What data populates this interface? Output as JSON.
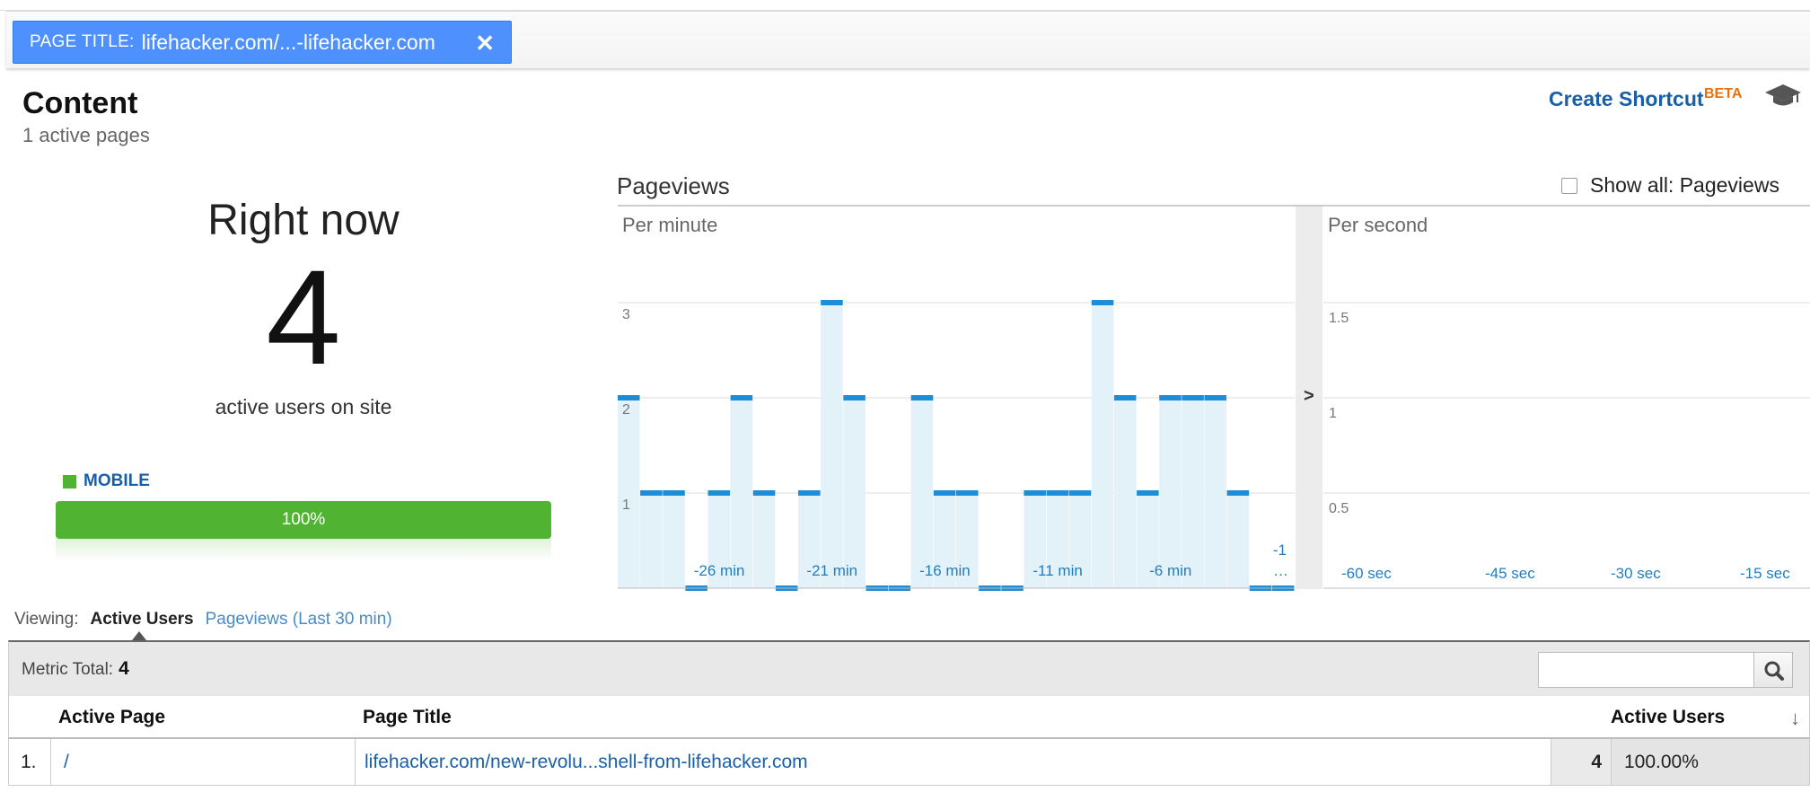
{
  "filter": {
    "label": "PAGE TITLE:",
    "value": "lifehacker.com/...-lifehacker.com",
    "close_glyph": "✕"
  },
  "header": {
    "title": "Content",
    "subtitle": "1 active pages",
    "shortcut_label": "Create Shortcut",
    "beta_label": "BETA"
  },
  "overview": {
    "right_now_label": "Right now",
    "active_users": "4",
    "active_users_label": "active users on site",
    "device": {
      "name": "MOBILE",
      "percent_label": "100%",
      "share": 1.0,
      "color": "#50b432"
    }
  },
  "pageviews": {
    "title": "Pageviews",
    "show_all_label": "Show all: Pageviews",
    "per_minute_label": "Per minute",
    "per_second_label": "Per second"
  },
  "chart_data": [
    {
      "type": "bar",
      "title": "Per minute",
      "x": [
        -30,
        -29,
        -28,
        -27,
        -26,
        -25,
        -24,
        -23,
        -22,
        -21,
        -20,
        -19,
        -18,
        -17,
        -16,
        -15,
        -14,
        -13,
        -12,
        -11,
        -10,
        -9,
        -8,
        -7,
        -6,
        -5,
        -4,
        -3,
        -2,
        -1
      ],
      "values": [
        2,
        1,
        1,
        0,
        1,
        2,
        1,
        0,
        1,
        3,
        2,
        0,
        0,
        2,
        1,
        1,
        0,
        0,
        1,
        1,
        1,
        3,
        2,
        1,
        2,
        2,
        2,
        1,
        0,
        0
      ],
      "x_tick_labels": [
        "-26 min",
        "-21 min",
        "-16 min",
        "-11 min",
        "-6 min"
      ],
      "x_last_label": [
        "-1",
        "…"
      ],
      "y_tick_labels": [
        "1",
        "2",
        "3"
      ],
      "ylim": [
        0,
        4
      ],
      "bar_color": "#1f8dd6",
      "fill_color": "#e3f1f9"
    },
    {
      "type": "bar",
      "title": "Per second",
      "x_tick_labels": [
        "-60 sec",
        "-45 sec",
        "-30 sec",
        "-15 sec"
      ],
      "y_tick_labels": [
        "0.5",
        "1",
        "1.5"
      ],
      "ylim": [
        0,
        2
      ],
      "values": []
    }
  ],
  "viewing": {
    "label": "Viewing:",
    "active_tab": "Active Users",
    "other_tab": "Pageviews (Last 30 min)"
  },
  "table": {
    "metric_total_label": "Metric Total:",
    "metric_total_value": "4",
    "columns": [
      "Active Page",
      "Page Title",
      "Active Users"
    ],
    "sort_glyph": "↓",
    "rows": [
      {
        "index": "1.",
        "page": "/",
        "title": "lifehacker.com/new-revolu...shell-from-lifehacker.com",
        "users": "4",
        "percent": "100.00%"
      }
    ]
  }
}
